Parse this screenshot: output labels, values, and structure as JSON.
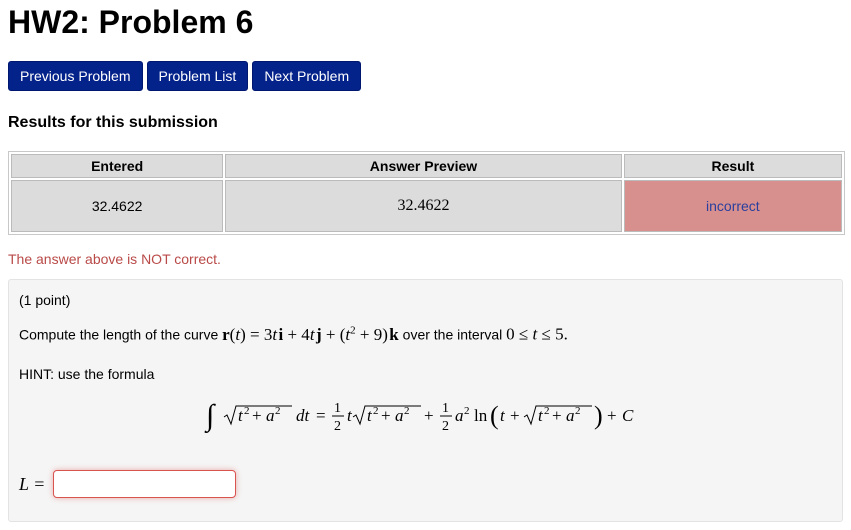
{
  "page": {
    "title": "HW2: Problem 6"
  },
  "nav": {
    "previous": "Previous Problem",
    "list": "Problem List",
    "next": "Next Problem"
  },
  "results": {
    "heading": "Results for this submission",
    "columns": [
      "Entered",
      "Answer Preview",
      "Result"
    ],
    "row": {
      "entered": "32.4622",
      "preview": "32.4622",
      "result": "incorrect"
    },
    "message": "The answer above is NOT correct."
  },
  "problem": {
    "points": "(1 point)",
    "prompt_prefix": "Compute the length of the curve",
    "prompt_middle": "over the interval",
    "hint": "HINT: use the formula",
    "answer_label": "L =",
    "answer_value": ""
  },
  "colors": {
    "button": "#03228a",
    "incorrect_bg": "#d8908f",
    "incorrect_text": "#2a3f9d",
    "warning_text": "#b94a48",
    "cell_bg": "#dcdcdc"
  }
}
